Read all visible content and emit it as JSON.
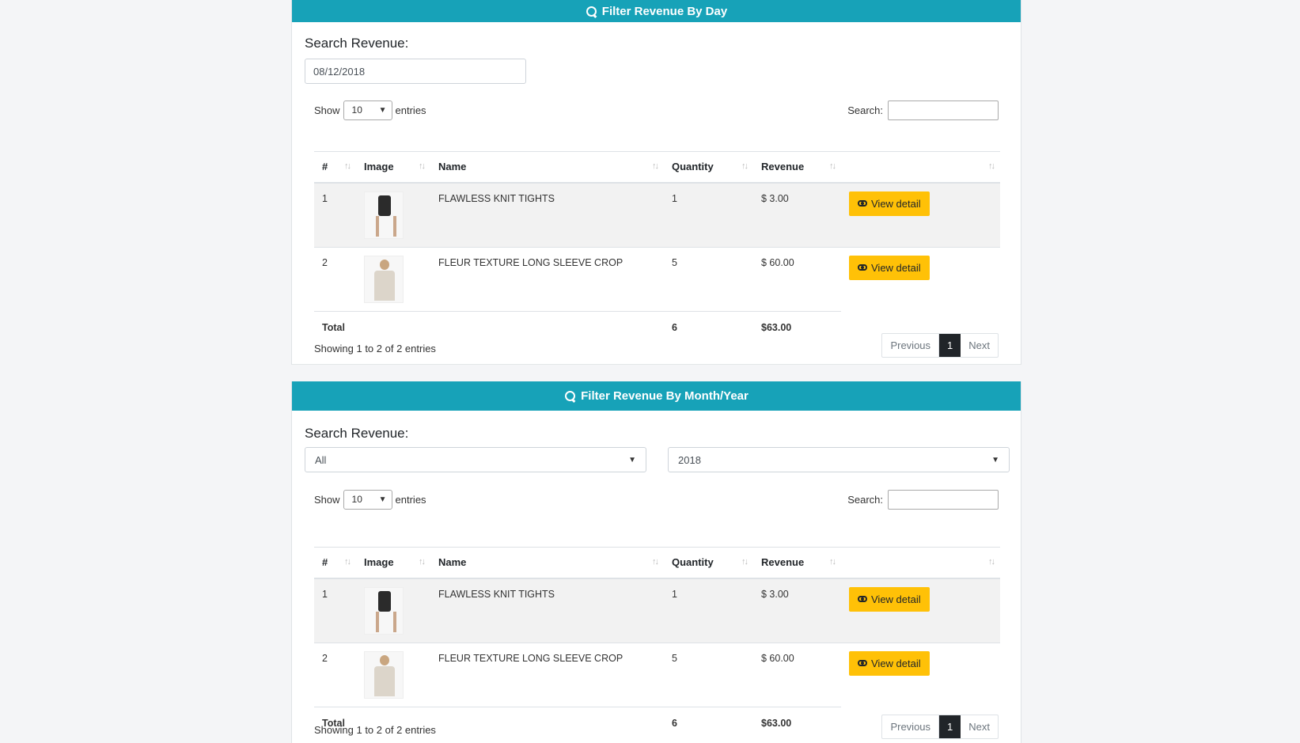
{
  "day_panel": {
    "title": "Filter Revenue By Day",
    "search_label": "Search Revenue:",
    "date_value": "08/12/2018",
    "table": {
      "show_label": "Show",
      "page_length": "10",
      "entries_label": "entries",
      "search_label": "Search:",
      "columns": [
        "#",
        "Image",
        "Name",
        "Quantity",
        "Revenue",
        ""
      ],
      "rows": [
        {
          "num": "1",
          "image": "tights",
          "name": "FLAWLESS KNIT TIGHTS",
          "quantity": "1",
          "revenue": "$ 3.00",
          "action": "View detail"
        },
        {
          "num": "2",
          "image": "crop",
          "name": "FLEUR TEXTURE LONG SLEEVE CROP",
          "quantity": "5",
          "revenue": "$ 60.00",
          "action": "View detail"
        }
      ],
      "total_label": "Total",
      "total_quantity": "6",
      "total_revenue": "$63.00",
      "info": "Showing 1 to 2 of 2 entries",
      "pager": {
        "previous": "Previous",
        "current": "1",
        "next": "Next"
      }
    }
  },
  "month_panel": {
    "title": "Filter Revenue By Month/Year",
    "search_label": "Search Revenue:",
    "month_value": "All",
    "year_value": "2018",
    "table": {
      "show_label": "Show",
      "page_length": "10",
      "entries_label": "entries",
      "search_label": "Search:",
      "columns": [
        "#",
        "Image",
        "Name",
        "Quantity",
        "Revenue",
        ""
      ],
      "rows": [
        {
          "num": "1",
          "image": "tights",
          "name": "FLAWLESS KNIT TIGHTS",
          "quantity": "1",
          "revenue": "$ 3.00",
          "action": "View detail"
        },
        {
          "num": "2",
          "image": "crop",
          "name": "FLEUR TEXTURE LONG SLEEVE CROP",
          "quantity": "5",
          "revenue": "$ 60.00",
          "action": "View detail"
        }
      ],
      "total_label": "Total",
      "total_quantity": "6",
      "total_revenue": "$63.00",
      "info": "Showing 1 to 2 of 2 entries",
      "pager": {
        "previous": "Previous",
        "current": "1",
        "next": "Next"
      }
    }
  },
  "colors": {
    "header": "#17a2b8",
    "button": "#ffc107",
    "pager_active": "#212529"
  }
}
